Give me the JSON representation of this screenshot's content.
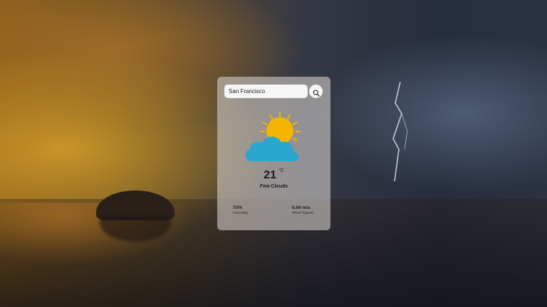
{
  "search": {
    "value": "San Francisco",
    "placeholder": "",
    "button_icon": "search-icon"
  },
  "weather": {
    "icon": "sun-behind-cloud-icon",
    "temperature": "21",
    "unit": "°C",
    "description": "Few Clouds"
  },
  "stats": {
    "humidity": {
      "value": "70%",
      "label": "Humidity"
    },
    "wind": {
      "value": "6.69 m/s",
      "label": "Wind Speed"
    }
  },
  "colors": {
    "sun": "#f4b400",
    "cloud": "#2aa6cf",
    "card": "#cdc8c3"
  }
}
